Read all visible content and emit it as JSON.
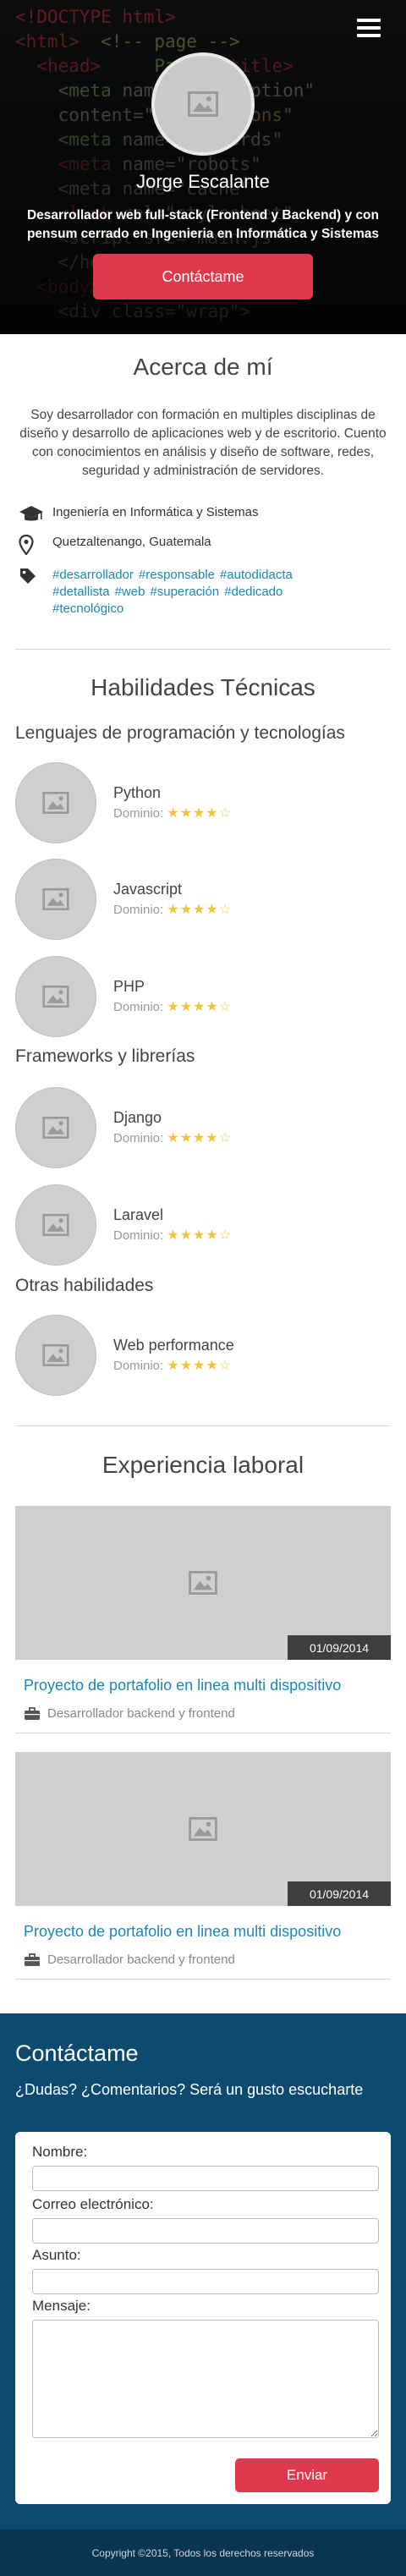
{
  "hero": {
    "name": "Jorge Escalante",
    "subtitle": "Desarrollador web full-stack (Frontend y Backend) y con pensum cerrado en Ingenieria en Informática y Sistemas",
    "cta_label": "Contáctame",
    "menu_icon": "hamburger-menu-icon"
  },
  "about": {
    "title": "Acerca de mí",
    "text": "Soy desarrollador con formación en multiples disciplinas de diseño y desarrollo de aplicaciones web y de escritorio. Cuento con conocimientos en análisis y diseño de software, redes, seguridad y administración de servidores.",
    "education": "Ingeniería en Informática y Sistemas",
    "location": "Quetzaltenango, Guatemala",
    "tags": [
      "#desarrollador",
      "#responsable",
      "#autodidacta",
      "#detallista",
      "#web",
      "#superación",
      "#dedicado",
      "#tecnológico"
    ]
  },
  "skills": {
    "title": "Habilidades Técnicas",
    "level_label": "Dominio:",
    "categories": [
      {
        "title": "Lenguajes de programación y tecnologías",
        "items": [
          {
            "name": "Python",
            "rating": 4,
            "max": 5
          },
          {
            "name": "Javascript",
            "rating": 4,
            "max": 5
          },
          {
            "name": "PHP",
            "rating": 4,
            "max": 5
          }
        ]
      },
      {
        "title": "Frameworks y librerías",
        "items": [
          {
            "name": "Django",
            "rating": 4,
            "max": 5
          },
          {
            "name": "Laravel",
            "rating": 4,
            "max": 5
          }
        ]
      },
      {
        "title": "Otras habilidades",
        "items": [
          {
            "name": "Web performance",
            "rating": 4,
            "max": 5
          }
        ]
      }
    ]
  },
  "experience": {
    "title": "Experiencia laboral",
    "items": [
      {
        "date": "01/09/2014",
        "title": "Proyecto de portafolio en linea multi dispositivo",
        "role": "Desarrollador backend y frontend"
      },
      {
        "date": "01/09/2014",
        "title": "Proyecto de portafolio en linea multi dispositivo",
        "role": "Desarrollador backend y frontend"
      }
    ]
  },
  "contact": {
    "title": "Contáctame",
    "subtitle": "¿Dudas? ¿Comentarios? Será un gusto escucharte",
    "name_label": "Nombre:",
    "email_label": "Correo electrónico:",
    "subject_label": "Asunto:",
    "message_label": "Mensaje:",
    "send_label": "Enviar"
  },
  "footer": {
    "text": "Copyright ©2015, Todos los derechos reservados"
  },
  "colors": {
    "accent": "#e0384d",
    "link": "#1a87b8",
    "contact_bg": "#0d4a70",
    "footer_bg": "#0a3550",
    "star": "#f0c43a"
  }
}
